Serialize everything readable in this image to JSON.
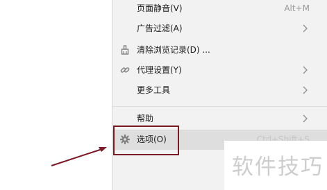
{
  "menu": {
    "items": [
      {
        "label": "页面静音(V)",
        "shortcut": "Alt+M"
      },
      {
        "label": "广告过滤(A)"
      },
      {
        "label": "清除浏览记录(D) ..."
      },
      {
        "label": "代理设置(Y)"
      },
      {
        "label": "更多工具"
      },
      {
        "label": "帮助"
      },
      {
        "label": "选项(O)",
        "shortcut": "Ctrl+Shift+S"
      }
    ]
  },
  "watermark": {
    "text": "软件技巧"
  },
  "colors": {
    "menu_background": "#f2f2f2",
    "highlight": "#dedede",
    "annotation_red": "#7a1a24",
    "watermark": "#cdcdcd"
  },
  "icons": {
    "clear_history": "broom-icon",
    "proxy": "link-icon",
    "options": "gear-icon"
  }
}
